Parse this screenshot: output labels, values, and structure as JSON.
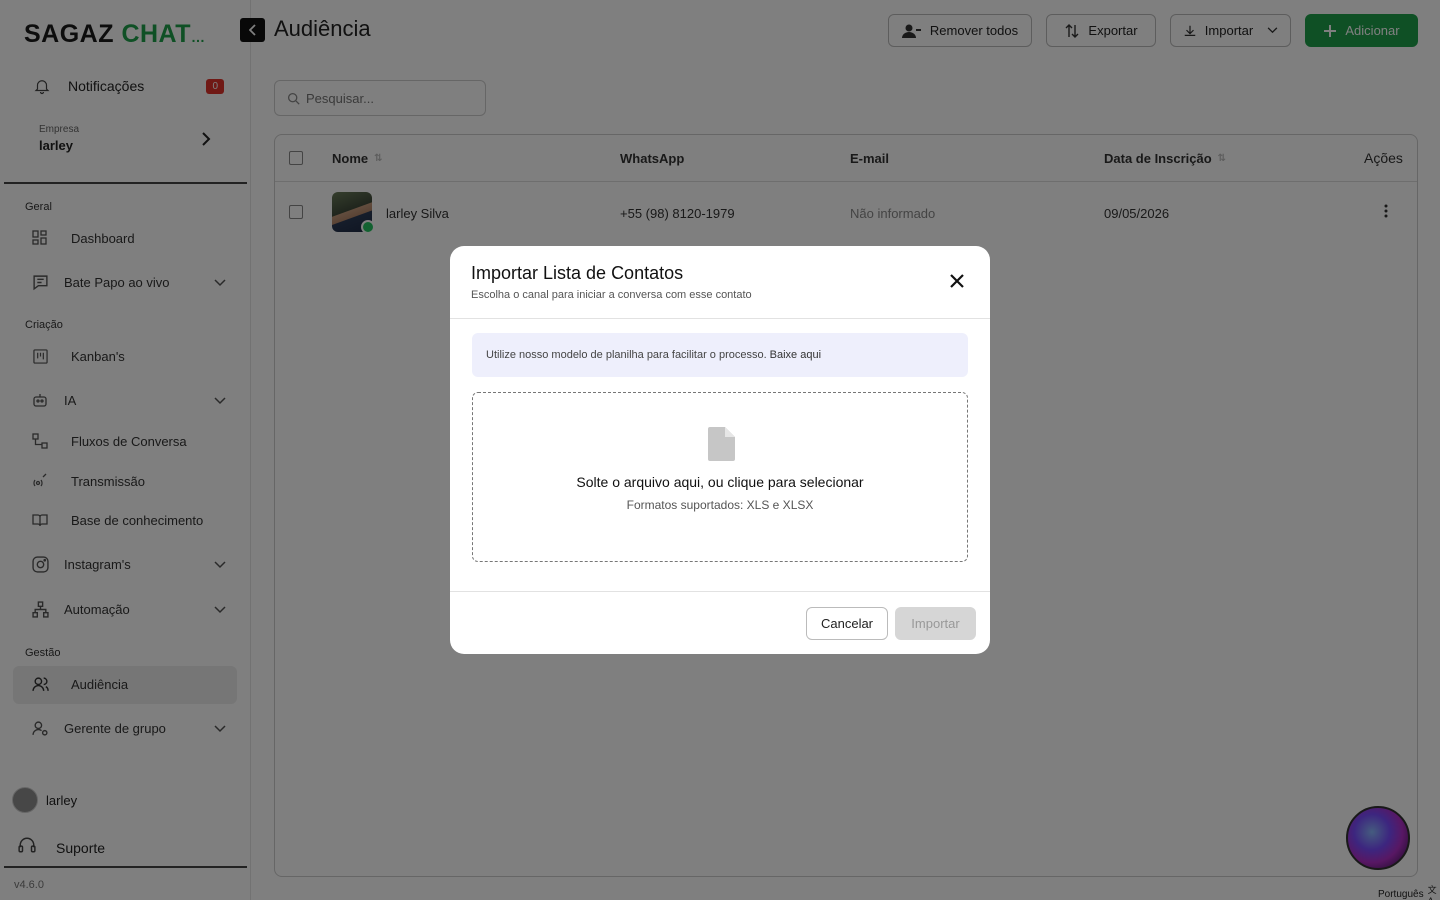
{
  "sidebar": {
    "logo_primary": "SAGAZ",
    "logo_secondary": "CHAT",
    "notifications": {
      "label": "Notificações",
      "count": "0"
    },
    "company": {
      "caption": "Empresa",
      "name": "larley"
    },
    "sections": {
      "geral": "Geral",
      "criacao": "Criação",
      "gestao": "Gestão"
    },
    "items": {
      "dashboard": "Dashboard",
      "bate_papo": "Bate Papo ao vivo",
      "kanbans": "Kanban's",
      "ia": "IA",
      "fluxos": "Fluxos de Conversa",
      "transmissao": "Transmissão",
      "base": "Base de conhecimento",
      "instagram": "Instagram's",
      "automacao": "Automação",
      "audiencia": "Audiência",
      "gerente": "Gerente de grupo"
    },
    "user_name": "larley",
    "support": "Suporte",
    "version": "v4.6.0"
  },
  "header": {
    "title": "Audiência",
    "remove_all": "Remover todos",
    "export": "Exportar",
    "import": "Importar",
    "add": "Adicionar"
  },
  "search": {
    "placeholder": "Pesquisar..."
  },
  "table": {
    "columns": {
      "name": "Nome",
      "whatsapp": "WhatsApp",
      "email": "E-mail",
      "date": "Data de Inscrição",
      "actions": "Ações"
    },
    "rows": [
      {
        "name": "larley Silva",
        "whatsapp": "+55 (98) 8120-1979",
        "email": "Não informado",
        "date": "09/05/2026"
      }
    ]
  },
  "modal": {
    "title": "Importar Lista de Contatos",
    "subtitle": "Escolha o canal para iniciar a conversa com esse contato",
    "info_text": "Utilize nosso modelo de planilha para facilitar o processo.",
    "info_link": "Baixe aqui",
    "drop_text": "Solte o arquivo aqui, ou clique para selecionar",
    "drop_formats": "Formatos suportados: XLS e XLSX",
    "cancel": "Cancelar",
    "import": "Importar"
  },
  "language": "Português",
  "colors": {
    "brand": "#1ea14a",
    "badge": "#e0332b"
  }
}
